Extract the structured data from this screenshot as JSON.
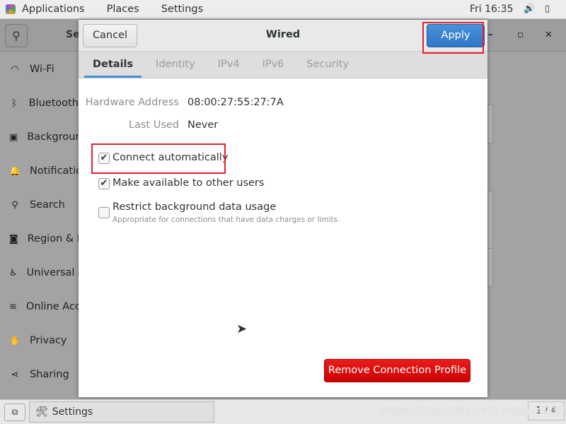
{
  "topbar": {
    "menus": [
      "Applications",
      "Places",
      "Settings"
    ],
    "clock": "Fri 16:35",
    "icons": [
      "volume-icon",
      "battery-icon"
    ]
  },
  "settings_window": {
    "title": "Settings",
    "sidebar": [
      {
        "label": "Wi-Fi",
        "icon": "wifi-icon"
      },
      {
        "label": "Bluetooth",
        "icon": "bluetooth-icon"
      },
      {
        "label": "Background",
        "icon": "background-icon"
      },
      {
        "label": "Notifications",
        "icon": "bell-icon"
      },
      {
        "label": "Search",
        "icon": "search-icon"
      },
      {
        "label": "Region & Language",
        "icon": "camera-icon"
      },
      {
        "label": "Universal Access",
        "icon": "accessibility-icon"
      },
      {
        "label": "Online Accounts",
        "icon": "online-accounts-icon"
      },
      {
        "label": "Privacy",
        "icon": "hand-icon"
      },
      {
        "label": "Sharing",
        "icon": "share-icon"
      }
    ]
  },
  "dialog": {
    "title": "Wired",
    "cancel": "Cancel",
    "apply": "Apply",
    "tabs": [
      "Details",
      "Identity",
      "IPv4",
      "IPv6",
      "Security"
    ],
    "active_tab": "Details",
    "hardware_address_label": "Hardware Address",
    "hardware_address": "08:00:27:55:27:7A",
    "last_used_label": "Last Used",
    "last_used": "Never",
    "options": [
      {
        "label": "Connect automatically",
        "checked": true
      },
      {
        "label": "Make available to other users",
        "checked": true
      },
      {
        "label": "Restrict background data usage",
        "checked": false,
        "hint": "Appropriate for connections that have data charges or limits."
      }
    ],
    "remove": "Remove Connection Profile",
    "accent": "#4a90d9",
    "danger": "#cc0000"
  },
  "taskbar": {
    "item": "Settings",
    "pager": "1 / 4",
    "watermark": "https://blog.csdn.net/Junson142099"
  }
}
